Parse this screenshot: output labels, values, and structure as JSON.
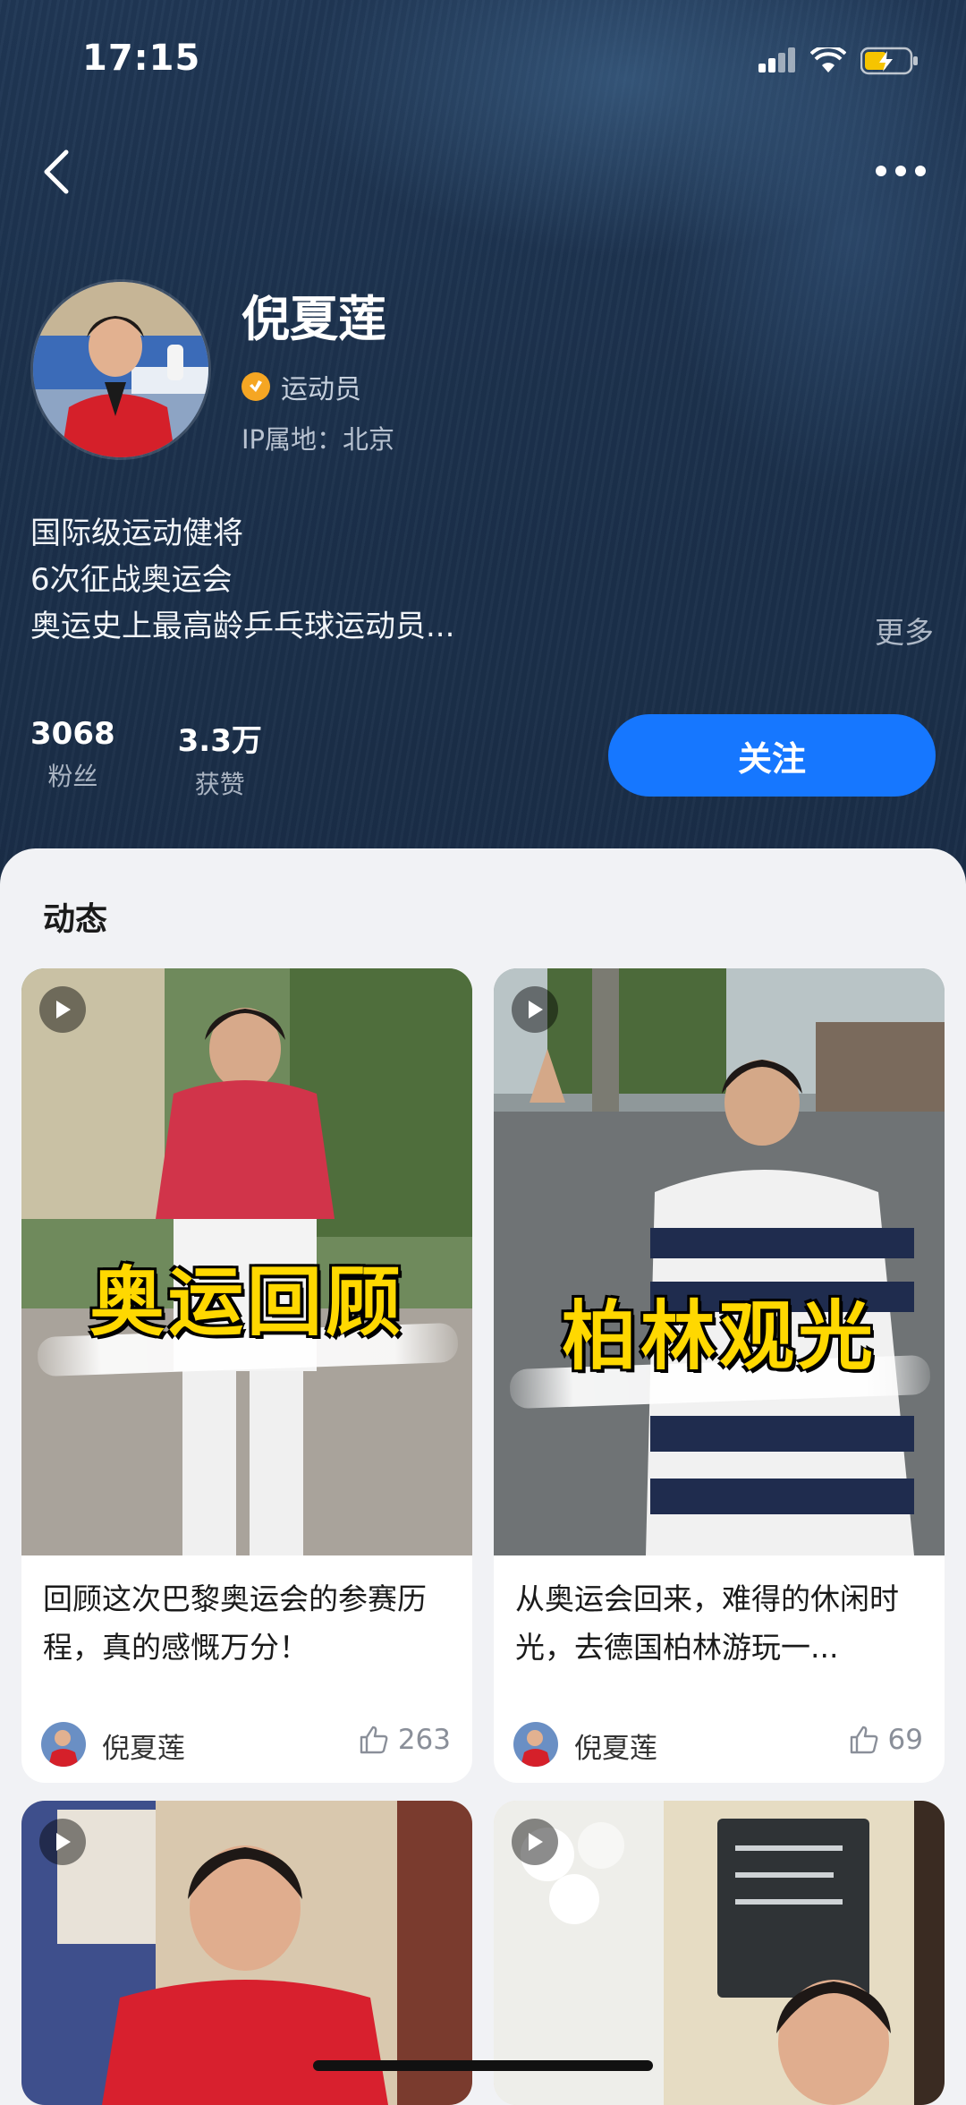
{
  "status_bar": {
    "time": "17:15"
  },
  "profile": {
    "name": "倪夏莲",
    "role": "运动员",
    "ip_location": "IP属地：北京",
    "bio_lines": [
      "国际级运动健将",
      "6次征战奥运会",
      "奥运史上最高龄乒乓球运动员..."
    ],
    "bio_more": "更多",
    "stats": [
      {
        "value": "3068",
        "label": "粉丝"
      },
      {
        "value": "3.3万",
        "label": "获赞"
      }
    ],
    "follow_label": "关注"
  },
  "feed": {
    "section_title": "动态",
    "cards": [
      {
        "overlay": "奥运回顾",
        "title": "回顾这次巴黎奥运会的参赛历程，真的感慨万分！",
        "author": "倪夏莲",
        "likes": "263"
      },
      {
        "overlay": "柏林观光",
        "title": "从奥运会回来，难得的休闲时光，去德国柏林游玩一...",
        "author": "倪夏莲",
        "likes": "69"
      },
      {
        "overlay": "",
        "title": "",
        "author": "",
        "likes": ""
      },
      {
        "overlay": "",
        "title": "",
        "author": "",
        "likes": ""
      }
    ]
  },
  "colors": {
    "accent": "#1677ff",
    "header_bg": "#1c314c",
    "overlay_text": "#ffd800",
    "badge": "#f5a623"
  }
}
